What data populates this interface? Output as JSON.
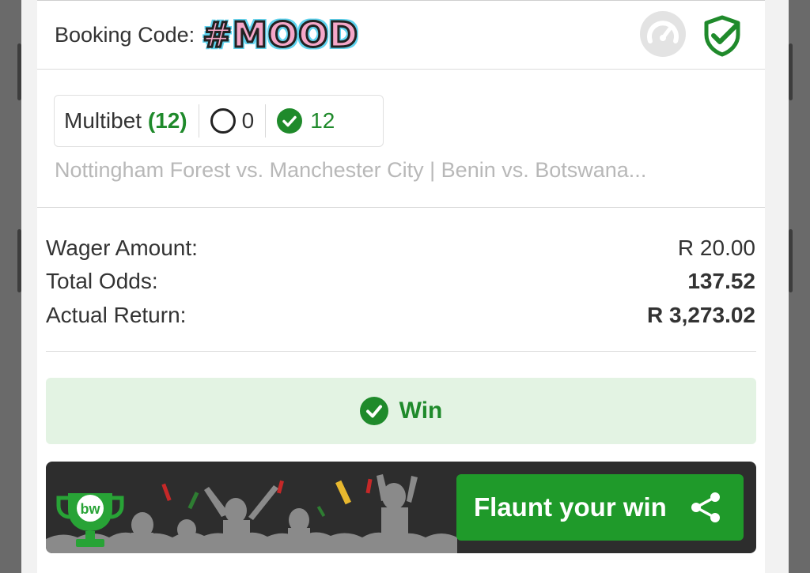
{
  "header": {
    "booking_label": "Booking Code:",
    "booking_code": "#MOOD",
    "icons": [
      "speedometer-icon",
      "shield-check-icon"
    ]
  },
  "bet": {
    "type_label": "Multibet",
    "selections_count": "(12)",
    "open_count": "0",
    "won_count": "12",
    "matches_text": "Nottingham Forest vs. Manchester City | Benin vs. Botswana..."
  },
  "summary": {
    "wager_label": "Wager Amount:",
    "wager_value": "R 20.00",
    "odds_label": "Total Odds:",
    "odds_value": "137.52",
    "return_label": "Actual Return:",
    "return_value": "R 3,273.02"
  },
  "result": {
    "status_label": "Win"
  },
  "banner": {
    "logo_text": "bw",
    "flaunt_label": "Flaunt your win"
  },
  "colors": {
    "accent_green": "#1f8a2b",
    "win_bg": "#e3f3e3",
    "banner_bg": "#2d2d2d"
  }
}
